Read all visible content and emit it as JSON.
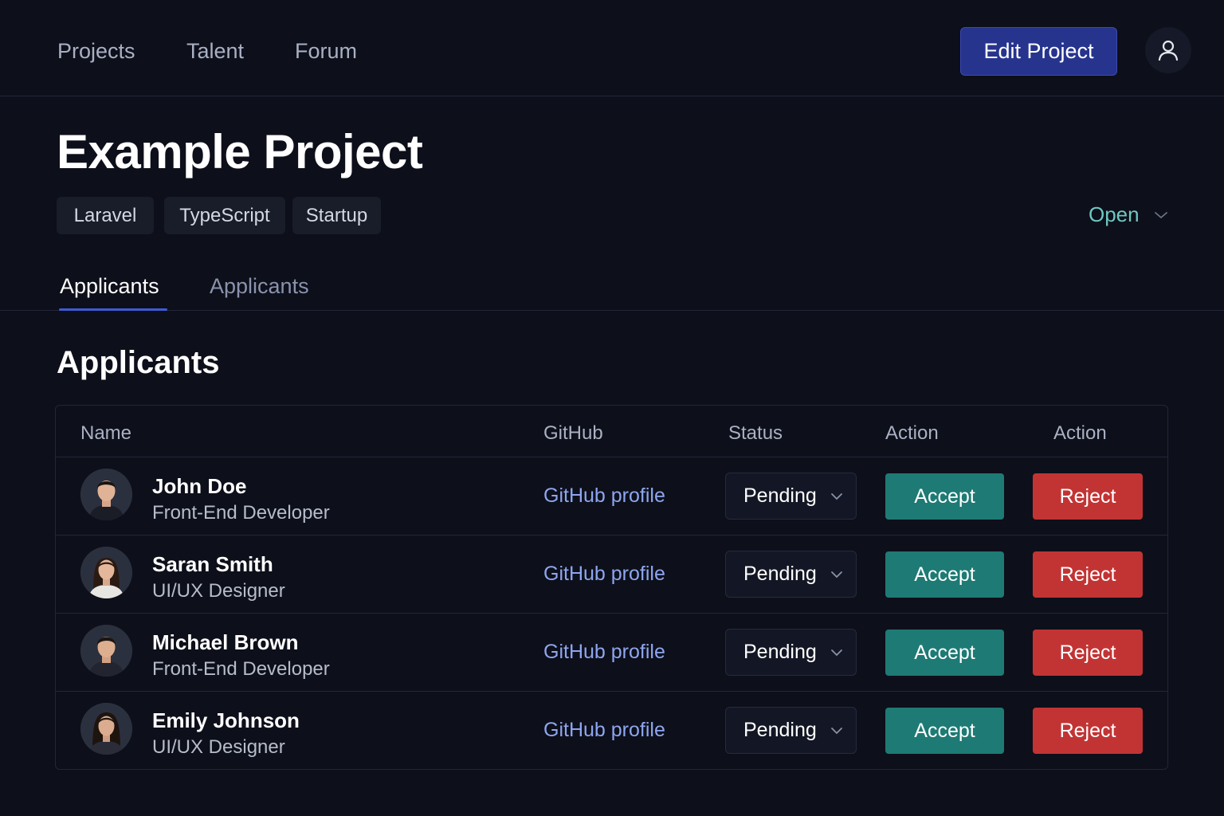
{
  "nav": {
    "links": [
      "Projects",
      "Talent",
      "Forum"
    ],
    "edit_button": "Edit Project",
    "profile_icon": "user-icon"
  },
  "project": {
    "title": "Example Project",
    "tags": [
      "Laravel",
      "TypeScript",
      "Startup"
    ],
    "status": "Open"
  },
  "tabs": [
    {
      "label": "Applicants",
      "active": true
    },
    {
      "label": "Applicants",
      "active": false
    }
  ],
  "section_title": "Applicants",
  "table": {
    "headers": [
      "Name",
      "GitHub",
      "Status",
      "Action",
      "Action"
    ],
    "rows": [
      {
        "name": "John Doe",
        "role": "Front-End Developer",
        "github": "GitHub profile",
        "status": "Pending",
        "accept": "Accept",
        "reject": "Reject"
      },
      {
        "name": "Saran Smith",
        "role": "UI/UX Designer",
        "github": "GitHub profile",
        "status": "Pending",
        "accept": "Accept",
        "reject": "Reject"
      },
      {
        "name": "Michael Brown",
        "role": "Front-End Developer",
        "github": "GitHub profile",
        "status": "Pending",
        "accept": "Accept",
        "reject": "Reject"
      },
      {
        "name": "Emily Johnson",
        "role": "UI/UX Designer",
        "github": "GitHub profile",
        "status": "Pending",
        "accept": "Accept",
        "reject": "Reject"
      }
    ]
  },
  "colors": {
    "background": "#0d0f1a",
    "primary": "#27348e",
    "accept": "#1e7a74",
    "reject": "#c23434",
    "link": "#8ea6ef",
    "status_open": "#6fc7c1",
    "tab_underline": "#3d5bd6"
  }
}
